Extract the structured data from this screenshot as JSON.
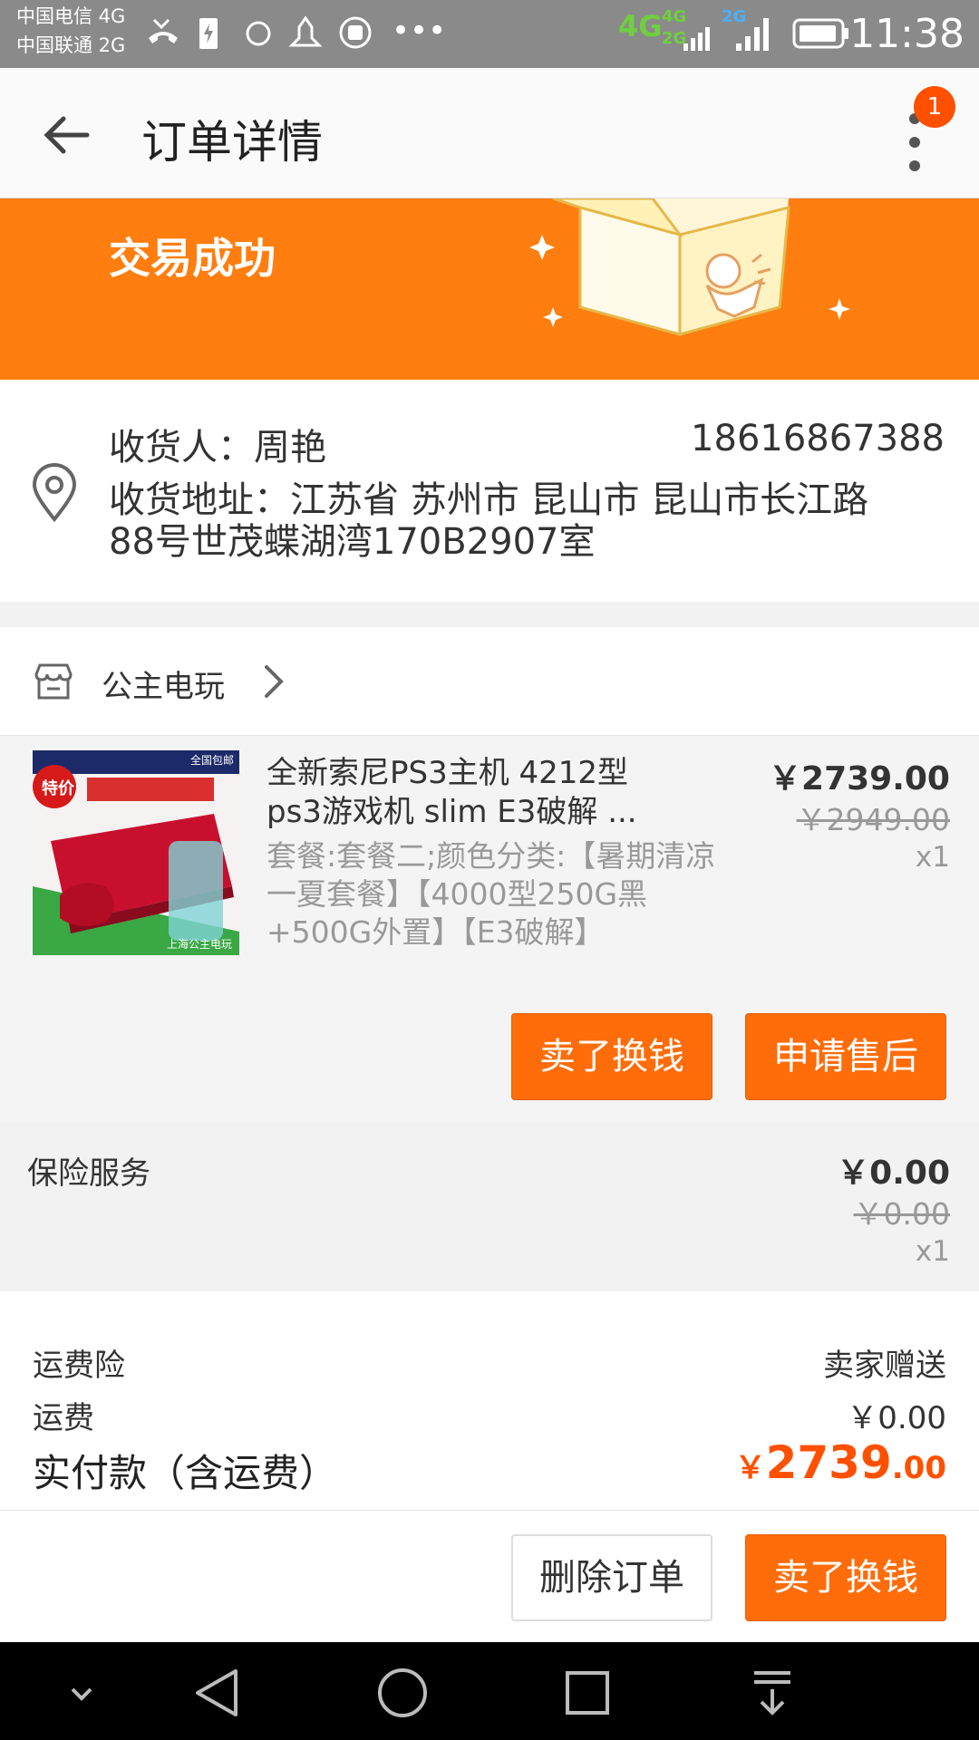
{
  "status_bar": {
    "carrier1": "中国电信 4G",
    "carrier2": "中国联通 2G",
    "net_primary": "4G",
    "net_a": "4G",
    "net_b": "2G",
    "net_c": "2G",
    "time": "11:38"
  },
  "app_bar": {
    "title": "订单详情",
    "badge": "1"
  },
  "banner": {
    "status": "交易成功",
    "accent": "#ff7e0f"
  },
  "address": {
    "recipient_label": "收货人：周艳",
    "phone": "18616867388",
    "address_line": "收货地址：江苏省 苏州市 昆山市 昆山市长江路88号世茂蝶湖湾170B2907室"
  },
  "shop": {
    "name": "公主电玩"
  },
  "item": {
    "title": "全新索尼PS3主机 4212型 ps3游戏机 slim E3破解 ...",
    "sku": "套餐:套餐二;颜色分类:【暑期清凉一夏套餐】【4000型250G黑+500G外置】【E3破解】",
    "price": "￥2739.00",
    "original_price": "￥2949.00",
    "qty": "x1",
    "thumb_tag": "特价",
    "thumb_corner": "全国包邮",
    "thumb_bottom": "上海公主电玩",
    "actions": [
      "卖了换钱",
      "申请售后"
    ]
  },
  "insurance": {
    "label": "保险服务",
    "price": "￥0.00",
    "original_price": "￥0.00",
    "qty": "x1"
  },
  "summary": {
    "shipping_insurance_label": "运费险",
    "shipping_insurance_value": "卖家赠送",
    "shipping_label": "运费",
    "shipping_value": "￥0.00",
    "total_label": "实付款（含运费）",
    "total_symbol": "￥",
    "total_int": "2739",
    "total_dec": ".00"
  },
  "footer_actions": {
    "delete": "删除订单",
    "sell": "卖了换钱"
  },
  "colors": {
    "orange": "#ff6c0a",
    "price_red": "#ff5000"
  }
}
